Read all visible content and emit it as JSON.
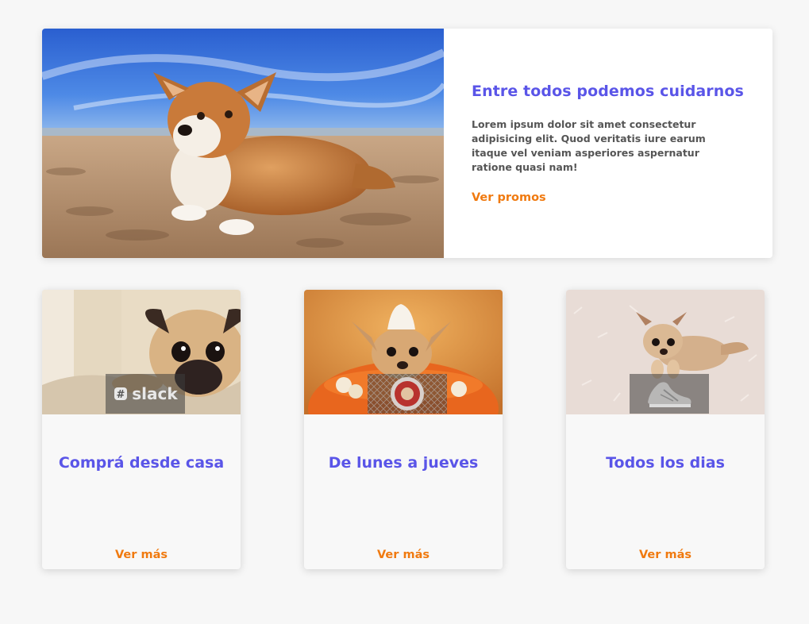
{
  "hero": {
    "image_alt": "Corgi lying on the beach sand",
    "title": "Entre todos podemos cuidarnos",
    "body": "Lorem ipsum dolor sit amet consectetur adipisicing elit. Quod veritatis iure earum itaque vel veniam asperiores aspernatur ratione quasi nam!",
    "link": "Ver promos"
  },
  "cards": [
    {
      "image_alt": "Pug resting on a blanket",
      "logo_text": "slack",
      "logo_icon": "slack-icon",
      "title": "Comprá desde casa",
      "link": "Ver más"
    },
    {
      "image_alt": "Chihuahua with cream on its head",
      "logo_icon": "badge-emblem-icon",
      "title": "De lunes a jueves",
      "link": "Ver más"
    },
    {
      "image_alt": "Chihuahua lying on a fluffy rug",
      "logo_icon": "sneaker-icon",
      "title": "Todos los dias",
      "link": "Ver más"
    }
  ],
  "colors": {
    "title": "#5a55e8",
    "link": "#f07a10",
    "body_text": "#555555",
    "background": "#f7f7f7"
  }
}
